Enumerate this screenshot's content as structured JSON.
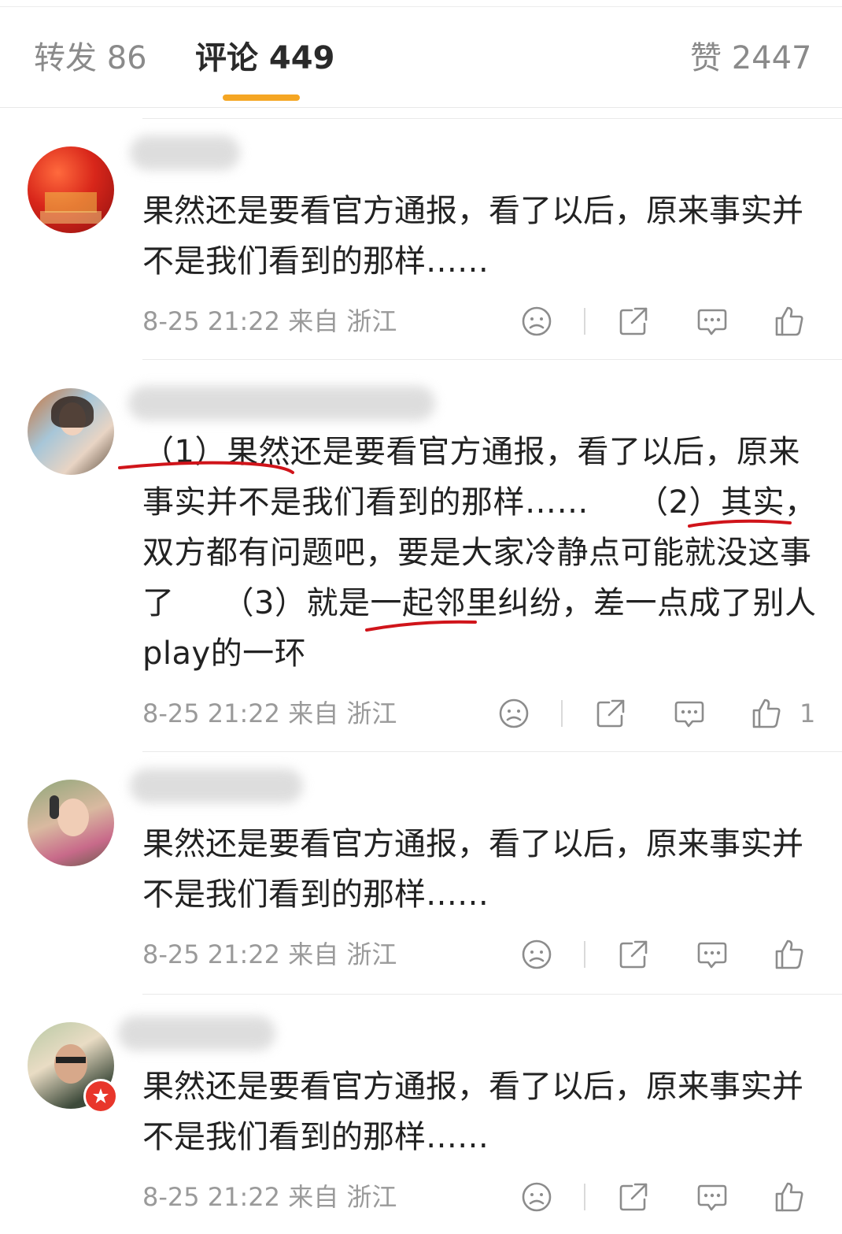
{
  "tabs": {
    "repost": "转发 86",
    "comments": "评论 449",
    "likes": "赞 2447"
  },
  "comments": [
    {
      "text": "果然还是要看官方通报，看了以后，原来事实并不是我们看到的那样……",
      "time": "8-25 21:22",
      "location": "来自 浙江",
      "likes": ""
    },
    {
      "text": "（1）果然还是要看官方通报，看了以后，原来事实并不是我们看到的那样……　　（2）其实，双方都有问题吧，要是大家冷静点可能就没这事了　　（3）就是一起邻里纠纷，差一点成了别人play的一环",
      "time": "8-25 21:22",
      "location": "来自 浙江",
      "likes": "1"
    },
    {
      "text": "果然还是要看官方通报，看了以后，原来事实并不是我们看到的那样……",
      "time": "8-25 21:22",
      "location": "来自 浙江",
      "likes": ""
    },
    {
      "text": "果然还是要看官方通报，看了以后，原来事实并不是我们看到的那样……",
      "time": "8-25 21:22",
      "location": "来自 浙江",
      "likes": ""
    }
  ],
  "colors": {
    "tab_accent": "#f5a623",
    "annotation_red": "#d0141a",
    "meta_gray": "#9a9a9a"
  },
  "icons": [
    "frown-icon",
    "share-icon",
    "comment-icon",
    "thumbs-up-icon"
  ]
}
